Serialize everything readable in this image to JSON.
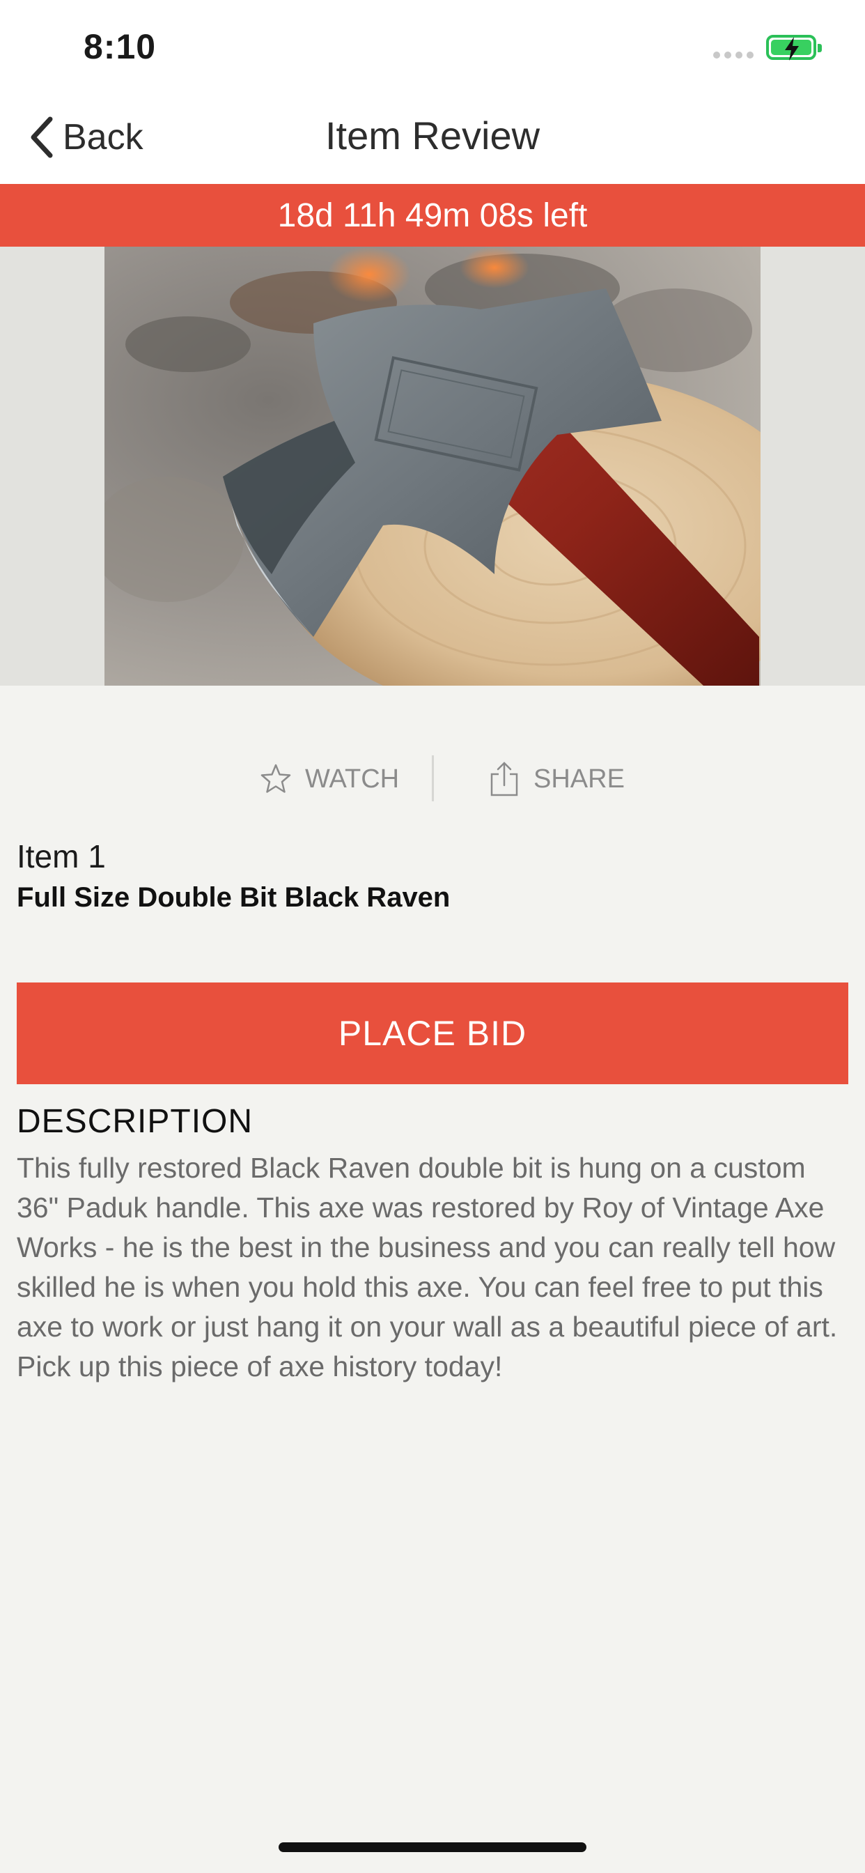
{
  "status_bar": {
    "time": "8:10",
    "signal_icon": "signal-dots-icon",
    "battery_icon": "battery-charging-icon"
  },
  "nav": {
    "back_label": "Back",
    "back_icon": "chevron-left-icon",
    "title": "Item Review"
  },
  "countdown": {
    "text": "18d 11h 49m 08s left",
    "color": "#e8503d"
  },
  "actions": {
    "watch_label": "WATCH",
    "watch_icon": "star-icon",
    "share_label": "SHARE",
    "share_icon": "share-icon"
  },
  "item": {
    "number": "Item 1",
    "name": "Full Size Double Bit Black Raven"
  },
  "bid_button": {
    "label": "PLACE BID",
    "color": "#e8503d"
  },
  "description": {
    "heading": "DESCRIPTION",
    "text": "This fully restored Black Raven double bit is hung on a custom 36\" Paduk handle. This axe was restored by Roy of Vintage Axe Works - he is the best in the business and you can really tell how skilled he is when you hold this axe. You can feel free to put this axe to work or just hang it on your wall as a beautiful piece of art. Pick up this piece of axe history today!"
  },
  "colors": {
    "accent": "#e8503d",
    "background": "#f3f3f0",
    "battery": "#38d060"
  }
}
